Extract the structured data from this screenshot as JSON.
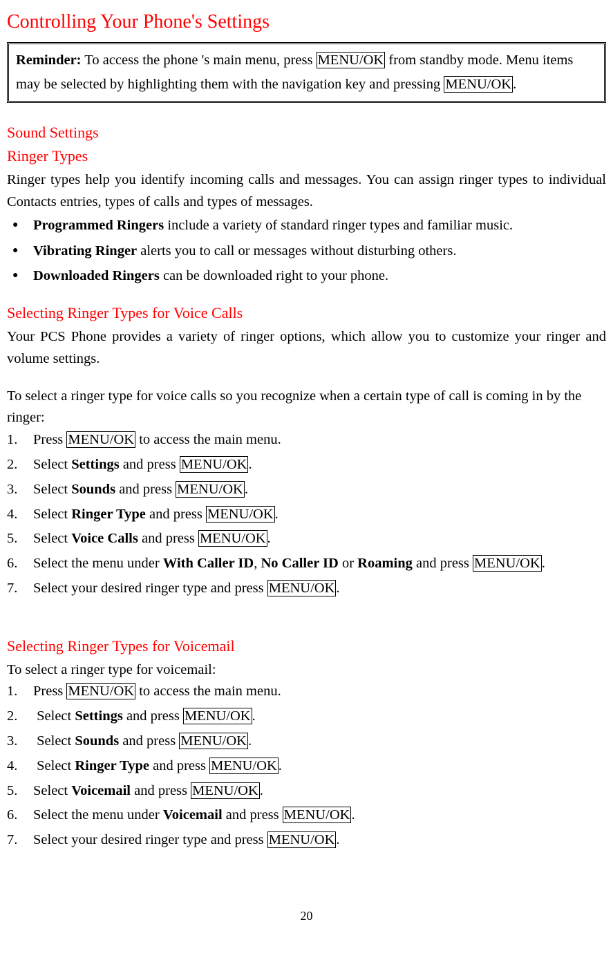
{
  "title": "Controlling Your Phone's Settings",
  "reminder": {
    "label": "Reminder:",
    "t1": " To access the phone 's main menu, press ",
    "key1": "MENU/OK",
    "t2": " from standby mode. Menu items may be selected by highlighting them with the navigation key and pressing ",
    "key2": "MENU/OK",
    "t3": "."
  },
  "h_sound": "Sound Settings",
  "h_ringer": "Ringer Types",
  "ringer_intro": "Ringer types help you identify incoming calls and messages. You can assign ringer types to individual Contacts entries, types of calls and types of messages.",
  "bullets": {
    "b1_bold": "Programmed Ringers",
    "b1_rest": " include a variety of standard ringer types and familiar music.",
    "b2_bold": "Vibrating Ringer",
    "b2_rest": " alerts you to call or messages without disturbing others.",
    "b3_bold": "Downloaded Ringers",
    "b3_rest": " can be downloaded right to your phone."
  },
  "h_voice": "Selecting Ringer Types for Voice Calls",
  "voice_intro": "Your PCS Phone provides a variety of ringer options, which allow you to customize your ringer and volume settings.",
  "voice_lead": "To select a ringer type for voice calls so you recognize when a certain type of call is coming in by the ringer:",
  "menu_ok": "MENU/OK",
  "voice_steps": {
    "s1a": "Press ",
    "s1b": " to access the main menu.",
    "s2a": "Select ",
    "s2bold": "Settings",
    "s2b": " and press ",
    "s3bold": "Sounds",
    "s4bold": "Ringer Type",
    "s5bold": "Voice Calls",
    "s6a": "Select the menu under ",
    "s6bold1": "With Caller ID",
    "s6comma": ", ",
    "s6bold2": "No Caller ID",
    "s6or": " or ",
    "s6bold3": "Roaming",
    "s6b": " and press ",
    "s7": "Select your desired ringer type and press ",
    "period": "."
  },
  "h_vm": "Selecting Ringer Types for Voicemail",
  "vm_lead": "To select a ringer type for voicemail:",
  "vm_steps": {
    "s5bold": "Voicemail",
    "s6bold": "Voicemail"
  },
  "page_num": "20"
}
